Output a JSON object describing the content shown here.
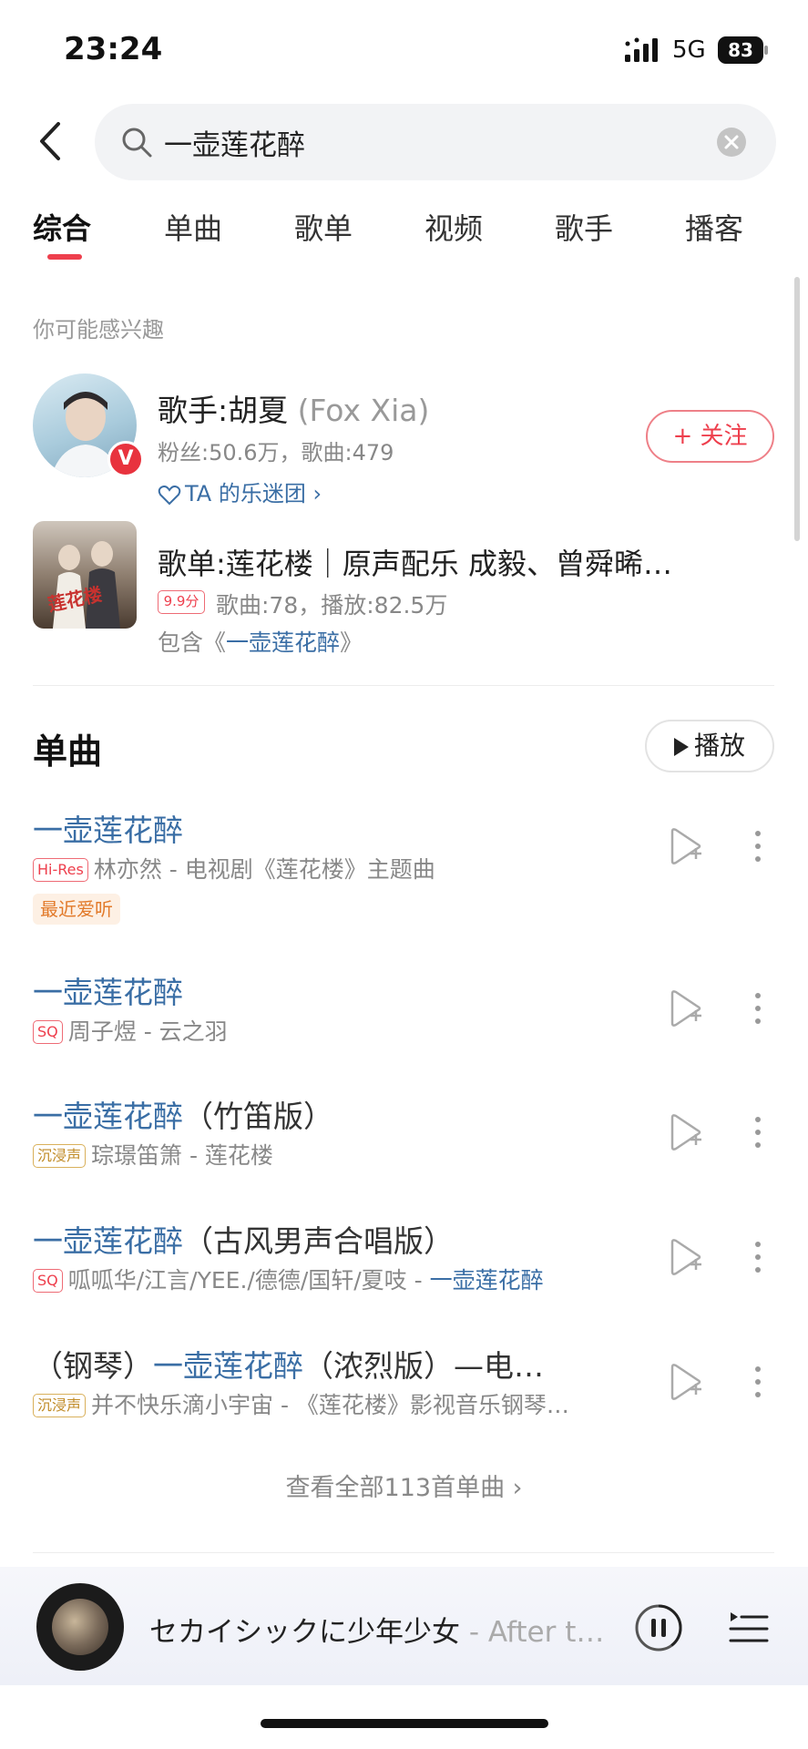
{
  "status_bar": {
    "time": "23:24",
    "network": "5G",
    "battery": "83"
  },
  "search": {
    "query": "一壶莲花醉"
  },
  "tabs": [
    {
      "label": "综合",
      "active": true
    },
    {
      "label": "单曲",
      "active": false
    },
    {
      "label": "歌单",
      "active": false
    },
    {
      "label": "视频",
      "active": false
    },
    {
      "label": "歌手",
      "active": false
    },
    {
      "label": "播客",
      "active": false
    }
  ],
  "interest": {
    "hint": "你可能感兴趣",
    "artist": {
      "name": "歌手:胡夏",
      "name_en": "(Fox Xia)",
      "badge": "V",
      "meta": "粉丝:50.6万，歌曲:479",
      "fan_club": "TA 的乐迷团 ›",
      "follow": "+ 关注"
    },
    "playlist": {
      "name": "歌单:莲花楼｜原声配乐 成毅、曾舜晞…",
      "cover_text": "莲花楼",
      "score": "9.9分",
      "meta": "歌曲:78，播放:82.5万",
      "contains_prefix": "包含《",
      "contains_title": "一壶莲花醉",
      "contains_suffix": "》"
    }
  },
  "songs_section": {
    "title": "单曲",
    "play_all": "播放"
  },
  "songs": [
    {
      "title": "一壶莲花醉",
      "badge": "Hi-Res",
      "sub": "林亦然 - 电视剧《莲花楼》主题曲",
      "tag": "最近爱听"
    },
    {
      "title": "一壶莲花醉",
      "badge": "SQ",
      "sub": "周子煜 - 云之羽"
    },
    {
      "title": "一壶莲花醉",
      "title_rest": "（竹笛版）",
      "badge": "沉浸声",
      "sub": "琮璟笛箫 - 莲花楼"
    },
    {
      "title": "一壶莲花醉",
      "title_rest": "（古风男声合唱版）",
      "badge": "SQ",
      "sub": "呱呱华/江言/YEE./德德/国轩/夏吱 - ",
      "sub_highlight": "一壶莲花醉"
    },
    {
      "title_prefix": "（钢琴）",
      "title": "一壶莲花醉",
      "title_rest": "（浓烈版）—电…",
      "badge": "沉浸声",
      "sub": "并不快乐滴小宇宙 - 《莲花楼》影视音乐钢琴…"
    }
  ],
  "view_all": "查看全部113首单曲 ›",
  "player": {
    "title": "セカイシックに少年少女",
    "artist": " - After t…"
  },
  "colors": {
    "accent_red": "#ee3f4d",
    "link_blue": "#3a6ea5",
    "tag_orange": "#e27a2a"
  }
}
